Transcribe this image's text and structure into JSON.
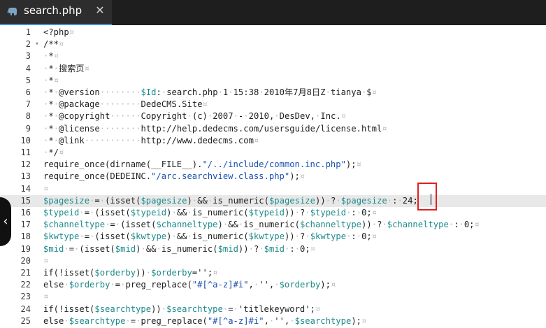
{
  "tab": {
    "title": "search.php",
    "close_label": "✕",
    "icon": "php-elephant-icon"
  },
  "colors": {
    "tab_bg": "#2d2d2d",
    "tabbar_bg": "#1e1e1e",
    "accent": "#3d8ee2",
    "current_line_bg": "#e8e8e8",
    "highlight_box": "#e02020"
  },
  "editor": {
    "current_line": 15,
    "lines": [
      {
        "n": "1",
        "fold": "",
        "text": "<?php¤"
      },
      {
        "n": "2",
        "fold": "▾",
        "text": "/**¤"
      },
      {
        "n": "3",
        "fold": "",
        "text": "·*¤"
      },
      {
        "n": "4",
        "fold": "",
        "text": "·*·搜索页¤"
      },
      {
        "n": "5",
        "fold": "",
        "text": "·*¤"
      },
      {
        "n": "6",
        "fold": "",
        "text": "·*·@version········$Id:·search.php·1·15:38·2010年7月8日Z·tianya·$¤"
      },
      {
        "n": "7",
        "fold": "",
        "text": "·*·@package········DedeCMS.Site¤"
      },
      {
        "n": "8",
        "fold": "",
        "text": "·*·@copyright······Copyright·(c)·2007·-·2010,·DesDev,·Inc.¤"
      },
      {
        "n": "9",
        "fold": "",
        "text": "·*·@license········http://help.dedecms.com/usersguide/license.html¤"
      },
      {
        "n": "10",
        "fold": "",
        "text": "·*·@link···········http://www.dedecms.com¤"
      },
      {
        "n": "11",
        "fold": "",
        "text": "·*/¤"
      },
      {
        "n": "12",
        "fold": "",
        "text": "require_once(dirname(__FILE__).\"/../include/common.inc.php\");¤"
      },
      {
        "n": "13",
        "fold": "",
        "text": "require_once(DEDEINC.\"/arc.searchview.class.php\");¤"
      },
      {
        "n": "14",
        "fold": "",
        "text": "¤"
      },
      {
        "n": "15",
        "fold": "",
        "text": "$pagesize·=·(isset($pagesize)·&&·is_numeric($pagesize))·?·$pagesize·:·24;"
      },
      {
        "n": "16",
        "fold": "",
        "text": "$typeid·=·(isset($typeid)·&&·is_numeric($typeid))·?·$typeid·:·0;¤"
      },
      {
        "n": "17",
        "fold": "",
        "text": "$channeltype·=·(isset($channeltype)·&&·is_numeric($channeltype))·?·$channeltype·:·0;¤"
      },
      {
        "n": "18",
        "fold": "",
        "text": "$kwtype·=·(isset($kwtype)·&&·is_numeric($kwtype))·?·$kwtype·:·0;¤"
      },
      {
        "n": "19",
        "fold": "",
        "text": "$mid·=·(isset($mid)·&&·is_numeric($mid))·?·$mid·:·0;¤"
      },
      {
        "n": "20",
        "fold": "",
        "text": "¤"
      },
      {
        "n": "21",
        "fold": "",
        "text": "if(!isset($orderby))·$orderby='';¤"
      },
      {
        "n": "22",
        "fold": "",
        "text": "else·$orderby·=·preg_replace(\"#[^a-z]#i\",·'',·$orderby);¤"
      },
      {
        "n": "23",
        "fold": "",
        "text": "¤"
      },
      {
        "n": "24",
        "fold": "",
        "text": "if(!isset($searchtype))·$searchtype·=·'titlekeyword';¤"
      },
      {
        "n": "25",
        "fold": "",
        "text": "else·$searchtype·=·preg_replace(\"#[^a-z]#i\",·'',·$searchtype);¤"
      }
    ]
  },
  "side_handle": {
    "icon": "chevron-left-icon",
    "glyph": "‹"
  }
}
